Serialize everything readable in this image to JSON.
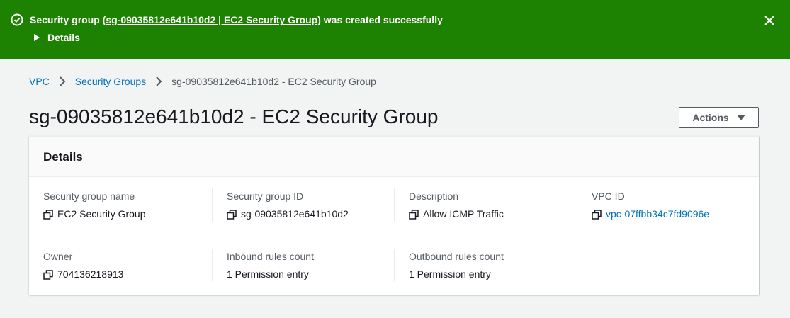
{
  "flash": {
    "prefix": "Security group (",
    "link_text": "sg-09035812e641b10d2 | EC2 Security Group",
    "suffix": ") was created successfully",
    "details_label": "Details"
  },
  "breadcrumb": {
    "items": [
      "VPC",
      "Security Groups"
    ],
    "current": "sg-09035812e641b10d2 - EC2 Security Group"
  },
  "page": {
    "title": "sg-09035812e641b10d2 - EC2 Security Group",
    "actions_label": "Actions"
  },
  "details": {
    "header": "Details",
    "fields": [
      {
        "label": "Security group name",
        "value": "EC2 Security Group"
      },
      {
        "label": "Security group ID",
        "value": "sg-09035812e641b10d2"
      },
      {
        "label": "Description",
        "value": "Allow ICMP Traffic"
      },
      {
        "label": "VPC ID",
        "value": "vpc-07ffbb34c7fd9096e"
      },
      {
        "label": "Owner",
        "value": "704136218913"
      },
      {
        "label": "Inbound rules count",
        "value": "1 Permission entry"
      },
      {
        "label": "Outbound rules count",
        "value": "1 Permission entry"
      }
    ]
  },
  "colors": {
    "success": "#1d8102",
    "link": "#0073bb",
    "page_bg": "#f2f3f3"
  }
}
